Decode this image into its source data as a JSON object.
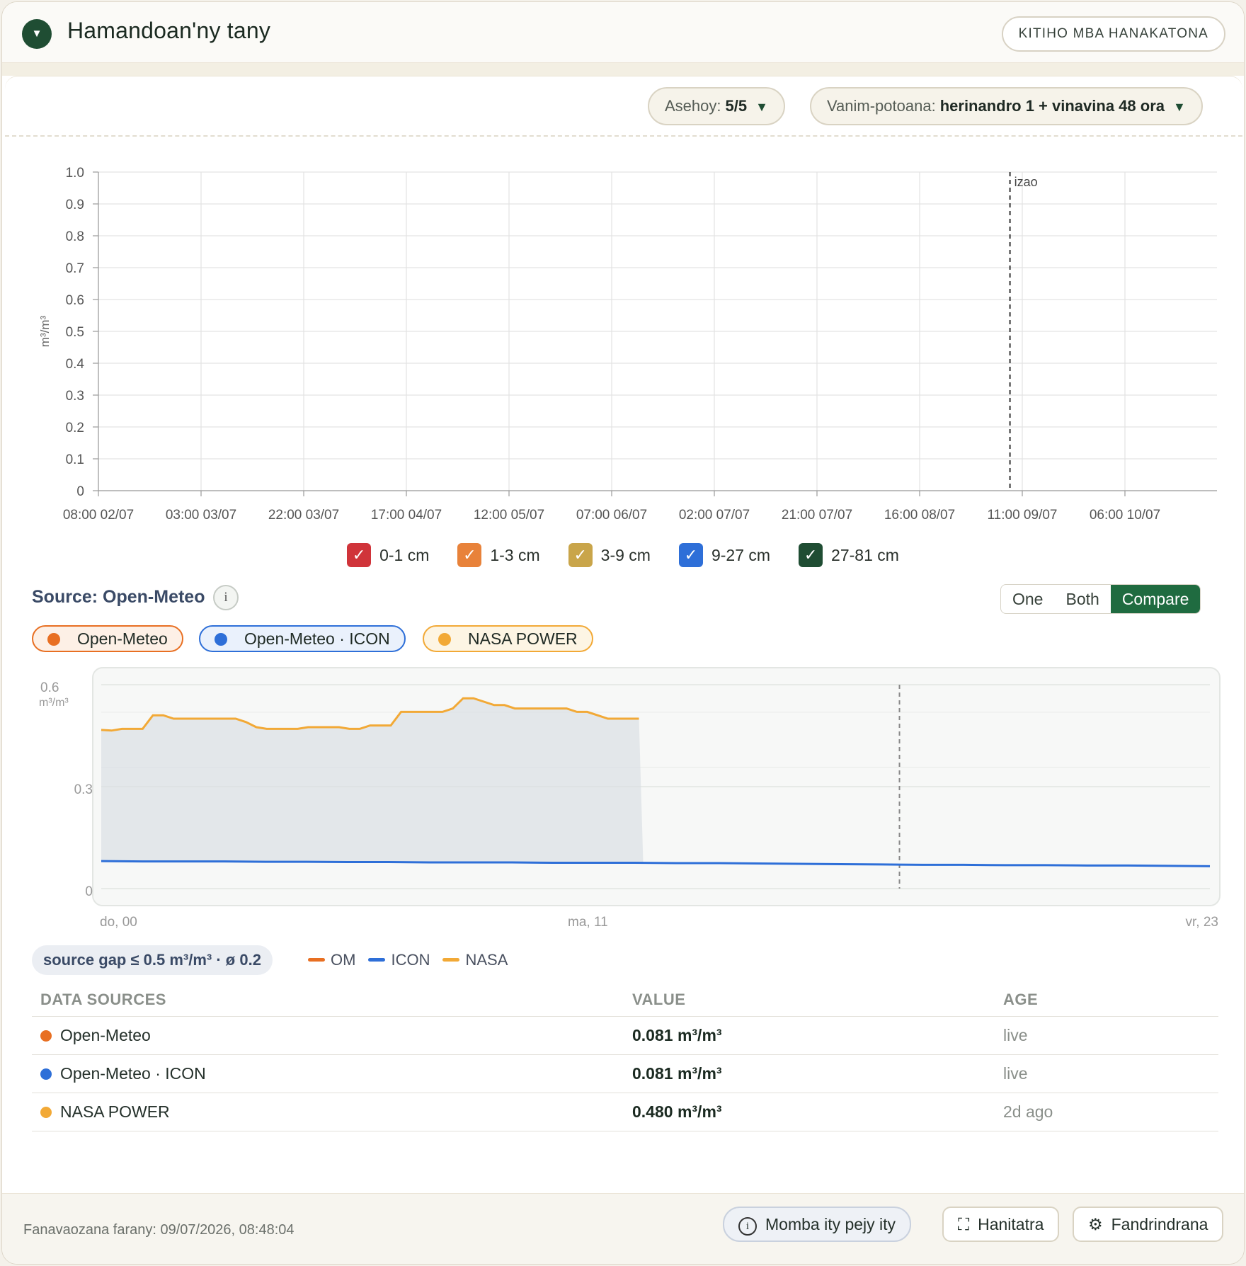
{
  "header": {
    "title": "Hamandoan'ny tany",
    "view_button": "KITIHO MBA HANAKATONA"
  },
  "filters": {
    "layers_label": "Asehoy:",
    "layers_value": "5/5",
    "range_label": "Vanim-potoana:",
    "range_value": "herinandro 1 + vinavina 48 ora"
  },
  "icons": {
    "collapse": "chevron-down-icon",
    "caret": "caret-down-icon",
    "info": "info-icon",
    "expand": "expand-icon",
    "settings": "gear-icon",
    "check": "check-icon"
  },
  "chart_data": [
    {
      "type": "line",
      "ylabel": "m³/m³",
      "ylim": [
        0,
        1.0
      ],
      "y_ticks": [
        "0",
        "0.1",
        "0.2",
        "0.3",
        "0.4",
        "0.5",
        "0.6",
        "0.7",
        "0.8",
        "0.9",
        "1.0"
      ],
      "x_ticks": [
        "08:00 02/07",
        "03:00 03/07",
        "22:00 03/07",
        "17:00 04/07",
        "12:00 05/07",
        "07:00 06/07",
        "02:00 07/07",
        "21:00 07/07",
        "16:00 08/07",
        "11:00 09/07",
        "06:00 10/07"
      ],
      "now_marker_label": "izao",
      "grid": true,
      "legend_position": "bottom",
      "series": [
        {
          "name": "0-1 cm",
          "color": "#d0343a",
          "checked": true,
          "values": []
        },
        {
          "name": "1-3 cm",
          "color": "#e8823a",
          "checked": true,
          "values": []
        },
        {
          "name": "3-9 cm",
          "color": "#c9a54a",
          "checked": true,
          "values": []
        },
        {
          "name": "9-27 cm",
          "color": "#2e6fd8",
          "checked": true,
          "values": []
        },
        {
          "name": "27-81 cm",
          "color": "#1f4d33",
          "checked": true,
          "values": []
        }
      ]
    },
    {
      "type": "line",
      "ylabel": "m³/m³",
      "ylim": [
        0,
        0.6
      ],
      "y_ticks": [
        "0",
        "0.3",
        "0.6"
      ],
      "x_ticks": [
        "do, 00",
        "ma, 11",
        "vr, 23"
      ],
      "grid": true,
      "series": [
        {
          "name": "ICON",
          "color": "#2e6fd8",
          "values": [
            0.081,
            0.08,
            0.08,
            0.08,
            0.079,
            0.079,
            0.078,
            0.078,
            0.077,
            0.077,
            0.077,
            0.076,
            0.076,
            0.076,
            0.075,
            0.075,
            0.074,
            0.073,
            0.072,
            0.071,
            0.07,
            0.07,
            0.069,
            0.069,
            0.068,
            0.068,
            0.067,
            0.066
          ]
        },
        {
          "name": "NASA",
          "color": "#f2a936",
          "values": [
            0.467,
            0.465,
            0.47,
            0.47,
            0.47,
            0.51,
            0.51,
            0.5,
            0.5,
            0.5,
            0.5,
            0.5,
            0.5,
            0.5,
            0.49,
            0.475,
            0.47,
            0.47,
            0.47,
            0.47,
            0.475,
            0.475,
            0.475,
            0.475,
            0.47,
            0.47,
            0.48,
            0.48,
            0.48,
            0.52,
            0.52,
            0.52,
            0.52,
            0.52,
            0.53,
            0.56,
            0.56,
            0.55,
            0.54,
            0.54,
            0.53,
            0.53,
            0.53,
            0.53,
            0.53,
            0.53,
            0.52,
            0.52,
            0.51,
            0.5,
            0.5,
            0.5,
            0.5
          ]
        }
      ]
    }
  ],
  "source": {
    "title": "Source: Open-Meteo",
    "modes": [
      "One",
      "Both",
      "Compare"
    ],
    "active_mode": "Compare",
    "chips": [
      {
        "label": "Open-Meteo",
        "color": "#e86f22",
        "bg": "#fdf0e6"
      },
      {
        "label": "Open-Meteo · ICON",
        "color": "#2e6fd8",
        "bg": "#eaf1fc"
      },
      {
        "label": "NASA POWER",
        "color": "#f2a936",
        "bg": "#fdf5e4"
      }
    ],
    "gap_summary": "source gap ≤ 0.5 m³/m³ · ø 0.2",
    "mini_legend": [
      {
        "label": "OM",
        "color": "#e86f22"
      },
      {
        "label": "ICON",
        "color": "#2e6fd8"
      },
      {
        "label": "NASA",
        "color": "#f2a936"
      }
    ]
  },
  "table": {
    "headers": [
      "DATA SOURCES",
      "VALUE",
      "AGE"
    ],
    "rows": [
      {
        "name": "Open-Meteo",
        "color": "#e86f22",
        "value": "0.081 m³/m³",
        "age": "live"
      },
      {
        "name": "Open-Meteo · ICON",
        "color": "#2e6fd8",
        "value": "0.081 m³/m³",
        "age": "live"
      },
      {
        "name": "NASA POWER",
        "color": "#f2a936",
        "value": "0.480 m³/m³",
        "age": "2d ago"
      }
    ]
  },
  "footer": {
    "updated": "Fanavaozana farany: 09/07/2026, 08:48:04",
    "info_button": "Momba ity pejy ity",
    "fullscreen_button": "Hanitatra",
    "settings_button": "Fandrindrana"
  }
}
